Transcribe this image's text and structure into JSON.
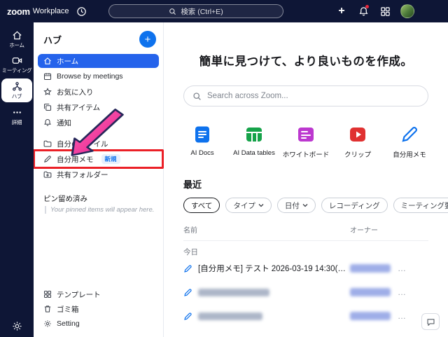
{
  "topbar": {
    "logo_primary": "zoom",
    "logo_secondary": "Workplace",
    "search_placeholder": "検索 (Ctrl+E)"
  },
  "rail": {
    "items": [
      {
        "label": "ホーム"
      },
      {
        "label": "ミーティング"
      },
      {
        "label": "ハブ",
        "selected": true
      },
      {
        "label": "詳細"
      }
    ]
  },
  "sidebar": {
    "title": "ハブ",
    "menu": [
      {
        "label": "ホーム",
        "selected": true
      },
      {
        "label": "Browse by meetings"
      },
      {
        "label": "お気に入り"
      },
      {
        "label": "共有アイテム"
      },
      {
        "label": "通知"
      },
      {
        "label": "自分のファイル"
      },
      {
        "label": "自分用メモ",
        "badge": "新規",
        "annotated": true
      },
      {
        "label": "共有フォルダー"
      }
    ],
    "pinned_title": "ピン留め済み",
    "pinned_empty": "Your pinned items will appear here.",
    "bottom": [
      {
        "label": "テンプレート"
      },
      {
        "label": "ゴミ箱"
      },
      {
        "label": "Setting"
      }
    ]
  },
  "main": {
    "heading": "簡単に見つけて、より良いものを作成。",
    "search_placeholder": "Search across Zoom...",
    "apps": [
      {
        "label": "AI Docs",
        "color": "#0E72ED"
      },
      {
        "label": "AI Data tables",
        "color": "#16A34A"
      },
      {
        "label": "ホワイトボード",
        "color": "#BC38CF"
      },
      {
        "label": "クリップ",
        "color": "#E03131"
      },
      {
        "label": "自分用メモ",
        "color": "#0E72ED"
      }
    ],
    "recent": {
      "title": "最近",
      "filters": [
        {
          "label": "すべて",
          "selected": true
        },
        {
          "label": "タイプ",
          "chevron": true
        },
        {
          "label": "日付",
          "chevron": true
        },
        {
          "label": "レコーディング"
        },
        {
          "label": "ミーティング要約"
        }
      ],
      "columns": {
        "name": "名前",
        "owner": "オーナー"
      },
      "group": "今日",
      "more_glyph": "…",
      "rows": [
        {
          "name": "[自分用メモ] テスト 2026-03-19 14:30(GMT+9:...",
          "owner_blurred": true
        },
        {
          "name": "",
          "name_blurred": true,
          "owner_blurred": true
        },
        {
          "name": "",
          "name_blurred": true,
          "owner_blurred": true
        }
      ]
    }
  },
  "colors": {
    "topbar_navy": "#0E1636",
    "accent_blue": "#0E72ED",
    "selected_pill_blue": "#2563EB",
    "annotation_red": "#EB2027",
    "annotation_arrow_pink": "#F0368F"
  }
}
